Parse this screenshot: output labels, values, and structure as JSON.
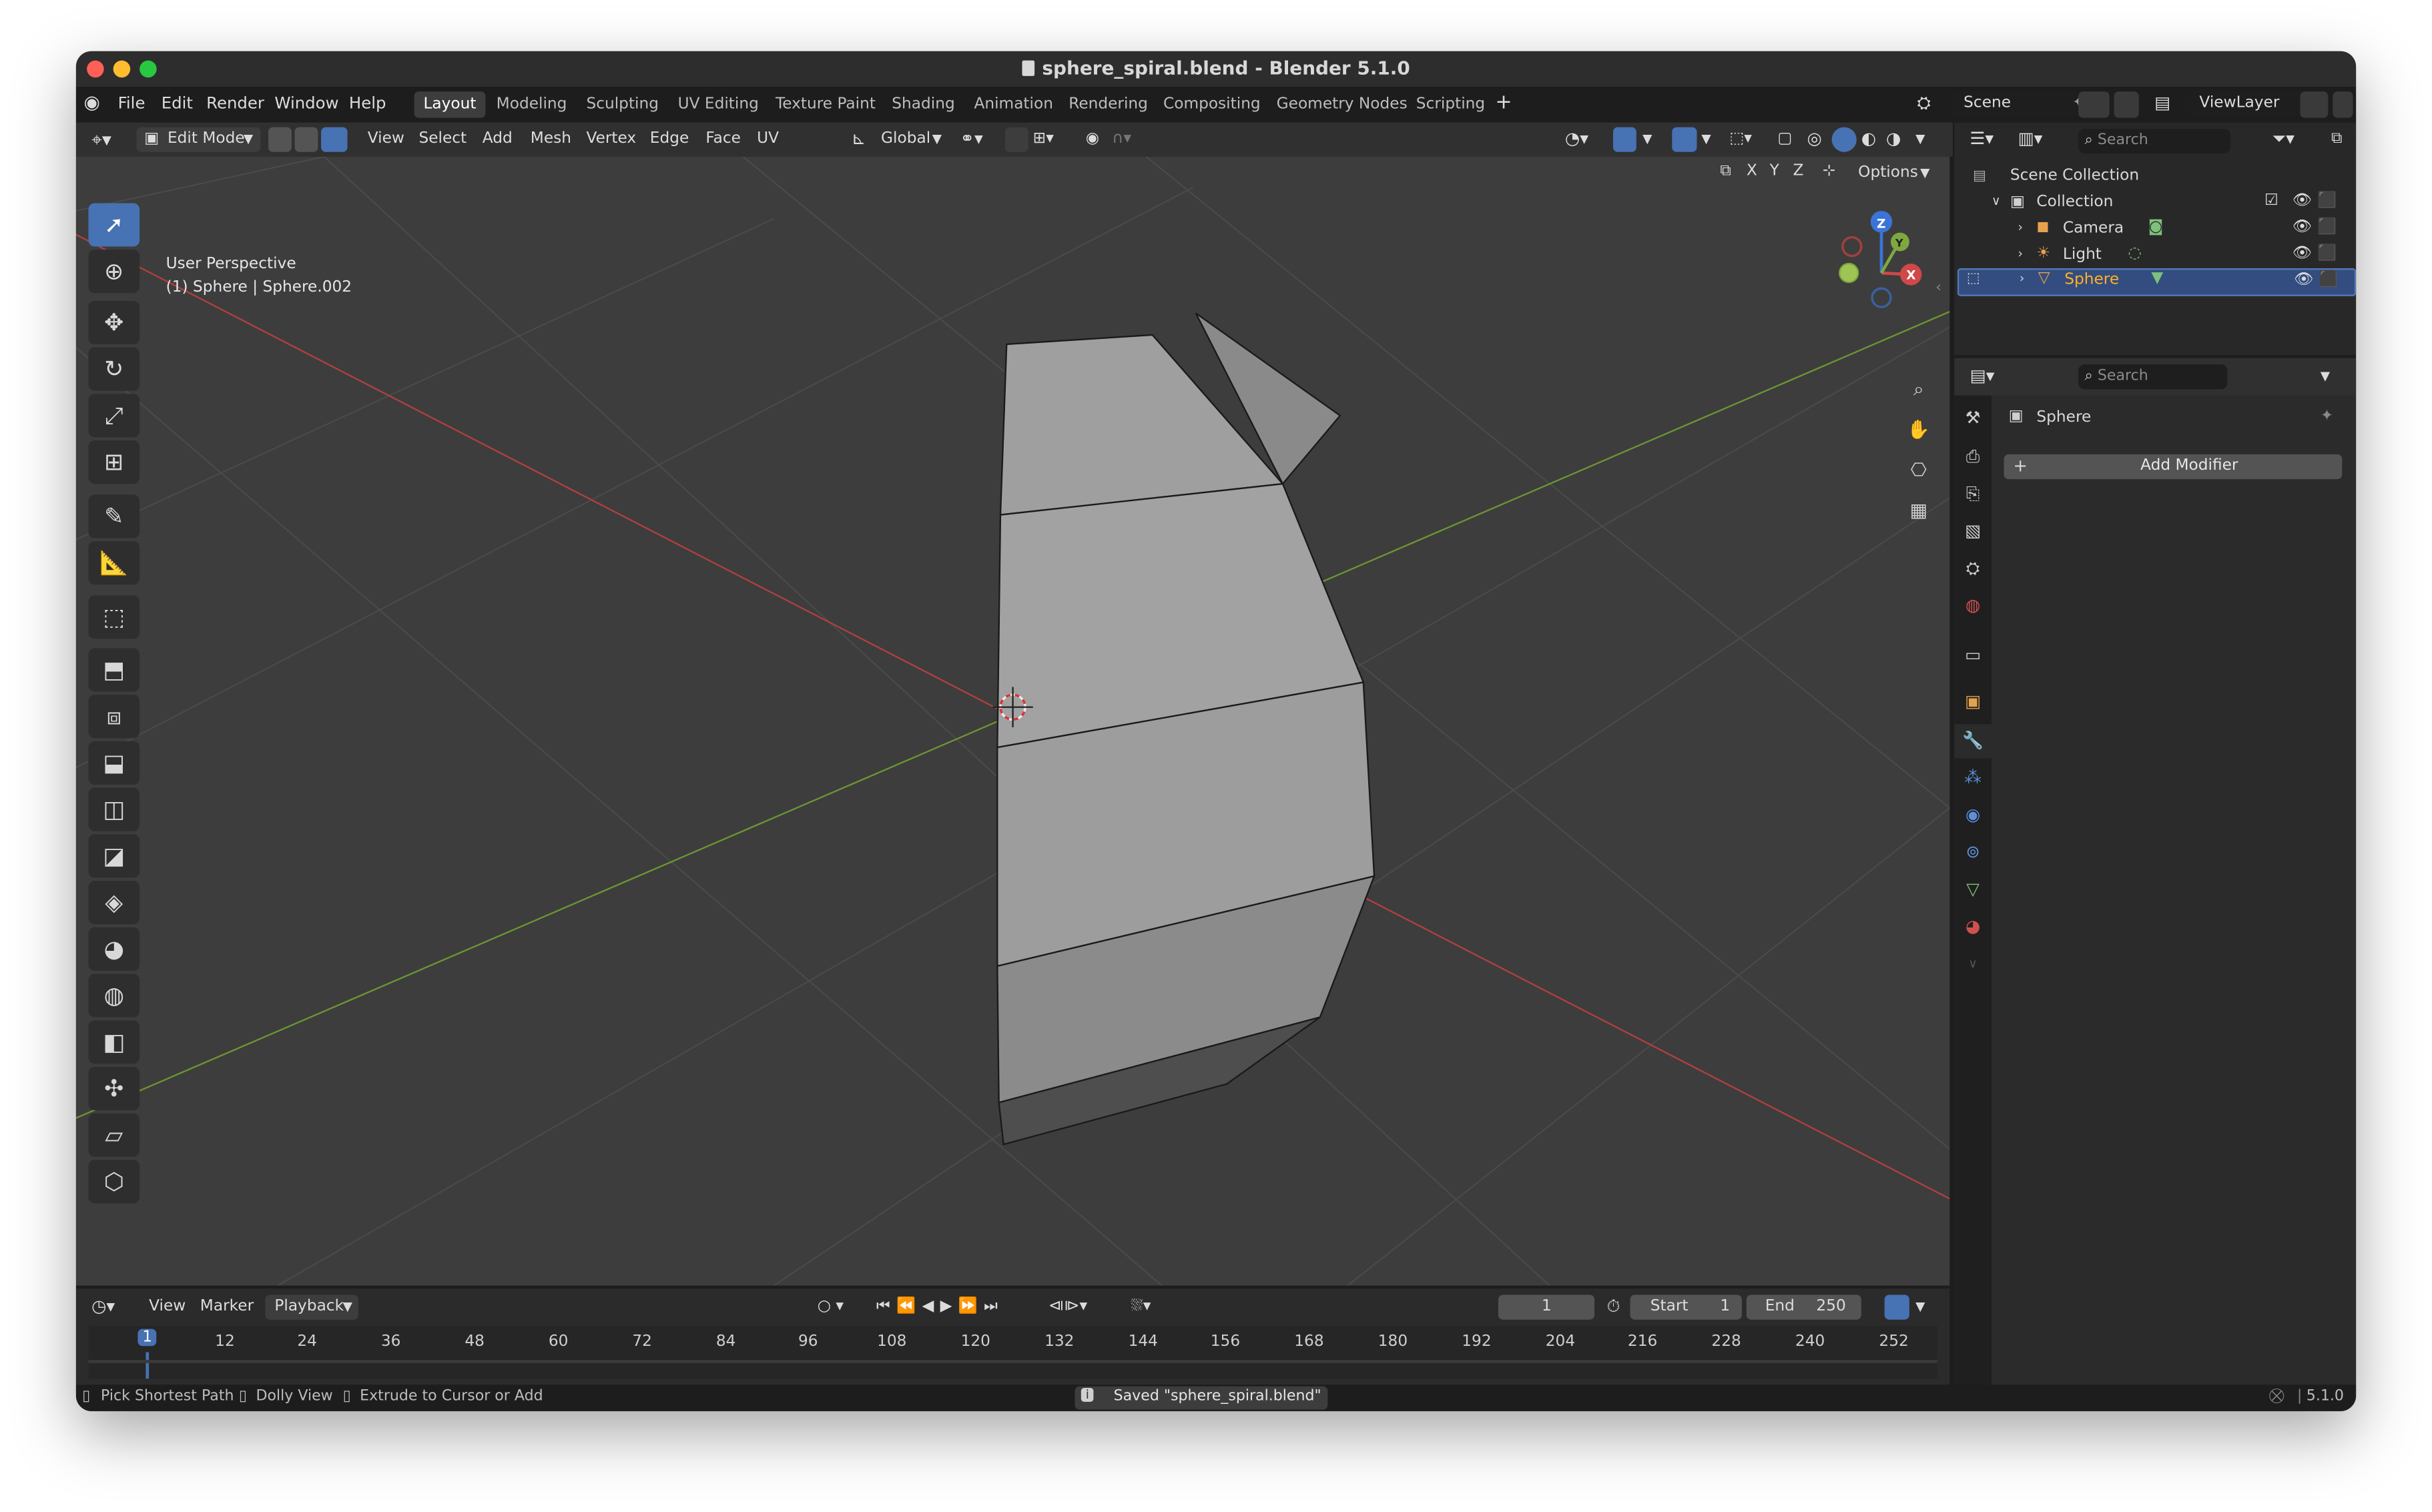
{
  "window": {
    "title": "sphere_spiral.blend - Blender 5.1.0"
  },
  "menu": [
    "File",
    "Edit",
    "Render",
    "Window",
    "Help"
  ],
  "workspaces": [
    "Layout",
    "Modeling",
    "Sculpting",
    "UV Editing",
    "Texture Paint",
    "Shading",
    "Animation",
    "Rendering",
    "Compositing",
    "Geometry Nodes",
    "Scripting"
  ],
  "active_workspace": "Layout",
  "scene": {
    "name": "Scene",
    "view_layer": "ViewLayer"
  },
  "viewport_header": {
    "mode": "Edit Mode",
    "menus": [
      "View",
      "Select",
      "Add",
      "Mesh",
      "Vertex",
      "Edge",
      "Face",
      "UV"
    ],
    "orientation": "Global",
    "options_label": "Options",
    "axis_labels": [
      "X",
      "Y",
      "Z"
    ]
  },
  "viewport": {
    "perspective_label": "User Perspective",
    "object_label": "(1) Sphere | Sphere.002",
    "gizmo": {
      "x": "X",
      "y": "Y",
      "z": "Z"
    }
  },
  "outliner": {
    "search_placeholder": "Search",
    "root": "Scene Collection",
    "collection": "Collection",
    "items": [
      {
        "name": "Camera",
        "selected": false
      },
      {
        "name": "Light",
        "selected": false
      },
      {
        "name": "Sphere",
        "selected": true
      }
    ]
  },
  "properties": {
    "search_placeholder": "Search",
    "object_name": "Sphere",
    "add_modifier_label": "Add Modifier"
  },
  "timeline": {
    "menus": [
      "View",
      "Marker",
      "Playback"
    ],
    "current_frame": "1",
    "start_label": "Start",
    "start_value": "1",
    "end_label": "End",
    "end_value": "250",
    "ruler": [
      "1",
      "12",
      "24",
      "36",
      "48",
      "60",
      "72",
      "84",
      "96",
      "108",
      "120",
      "132",
      "144",
      "156",
      "168",
      "180",
      "192",
      "204",
      "216",
      "228",
      "240",
      "252"
    ]
  },
  "statusbar": {
    "hint1": "Pick Shortest Path",
    "hint2": "Dolly View",
    "hint3": "Extrude to Cursor or Add",
    "message": "Saved \"sphere_spiral.blend\"",
    "version": "5.1.0"
  },
  "colors": {
    "accent": "#4772b3",
    "selected_text": "#ffaf29",
    "x_axis": "#d04848",
    "y_axis": "#7ea83f",
    "z_axis": "#3a74d8"
  }
}
